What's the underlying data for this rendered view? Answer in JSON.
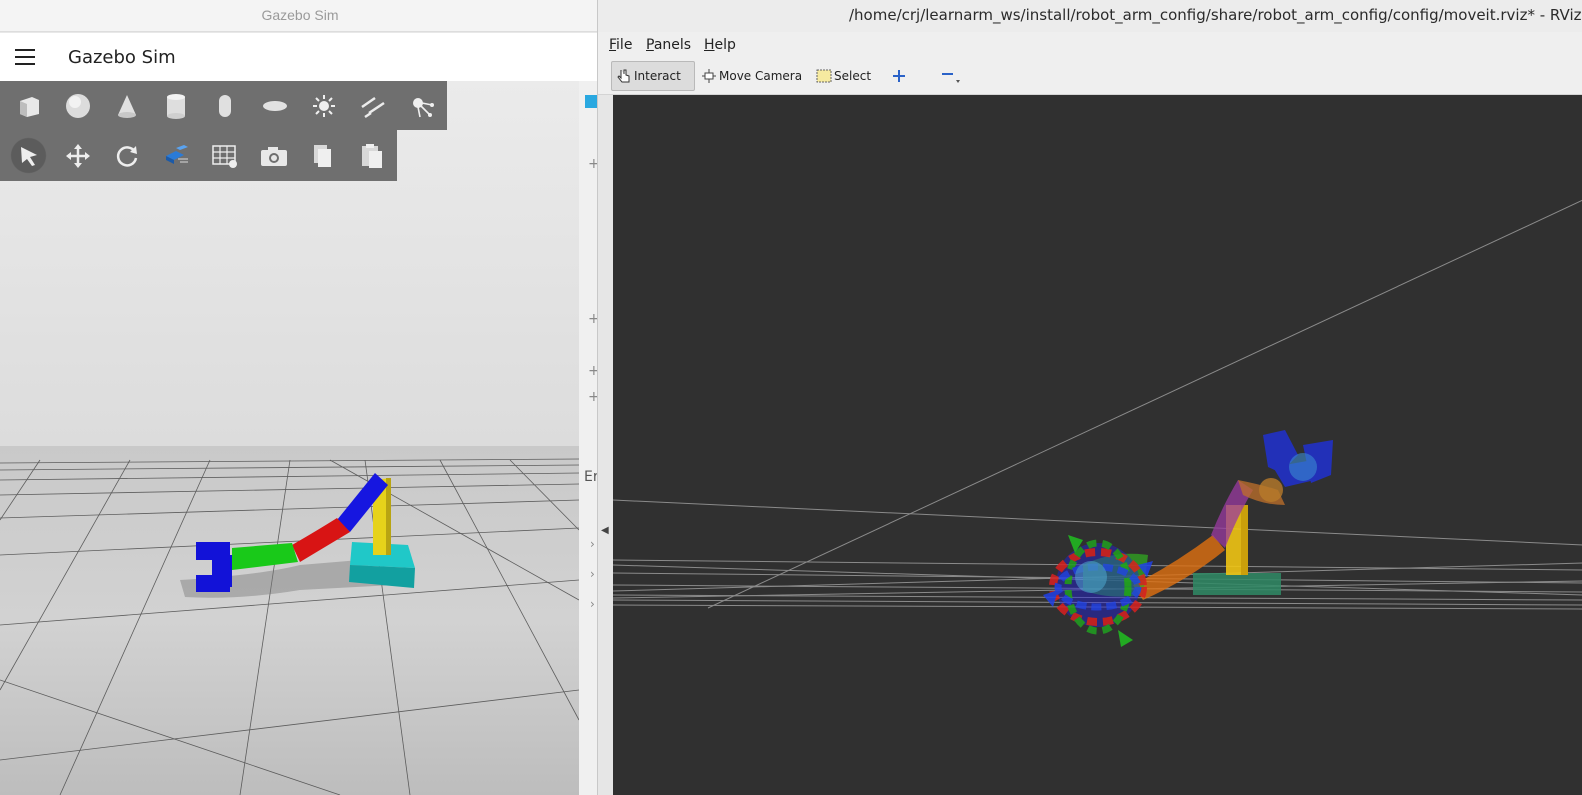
{
  "gazebo": {
    "window_title": "Gazebo Sim",
    "app_title": "Gazebo Sim",
    "shape_tools": [
      "box-icon",
      "sphere-icon",
      "cone-icon",
      "cylinder-icon",
      "capsule-icon",
      "ellipsoid-icon",
      "sun-light-icon",
      "directional-light-icon",
      "spot-light-icon"
    ],
    "transform_tools": [
      "select-arrow-icon",
      "translate-icon",
      "rotate-icon",
      "snap-icon",
      "grid-icon",
      "camera-screenshot-icon",
      "copy-icon",
      "paste-icon"
    ]
  },
  "side_panel": {
    "partial_label": "Er"
  },
  "rviz": {
    "window_title": "/home/crj/learnarm_ws/install/robot_arm_config/share/robot_arm_config/config/moveit.rviz* - RViz",
    "menu": [
      "File",
      "Panels",
      "Help"
    ],
    "toolbar": {
      "interact": "Interact",
      "move_camera": "Move Camera",
      "select": "Select"
    }
  },
  "colors": {
    "gazebo_toolbar": "#6f6f6f",
    "rviz_background": "#303030",
    "arm_blue": "#1010d0",
    "arm_green": "#18c818",
    "arm_red": "#d01010",
    "arm_yellow": "#e6d21a",
    "base_teal": "#1ab4b4"
  }
}
